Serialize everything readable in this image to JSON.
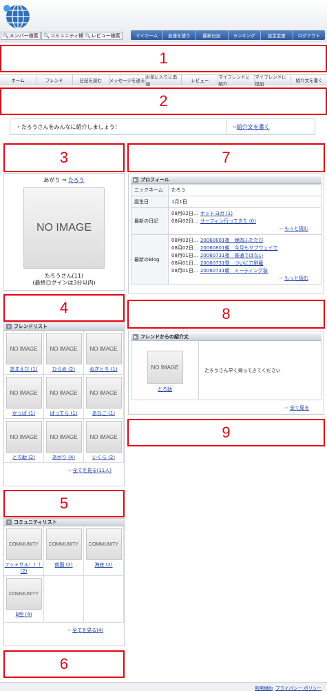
{
  "header": {
    "search": [
      "メンバー検索",
      "コミュニティ検索",
      "レビュー検索"
    ],
    "nav": [
      "マイホーム",
      "友達を誘う",
      "最新日記",
      "ランキング",
      "設定変更",
      "ログアウト"
    ]
  },
  "markers": [
    "1",
    "2",
    "3",
    "4",
    "5",
    "6",
    "7",
    "8",
    "9"
  ],
  "tabs": [
    "ホーム",
    "フレンド",
    "日記を読む",
    "メッセージを送る",
    "お気に入りに追加",
    "レビュー",
    "マイフレンドに紹介",
    "マイフレンドに追加",
    "紹介文を書く"
  ],
  "intro": {
    "text": "・たろうさんをみんなに紹介しましょう！",
    "link": "紹介文を書く"
  },
  "profile_photo": {
    "prefix": "あがり ⇒",
    "link": "たろう",
    "image": "NO IMAGE",
    "name": "たろうさん(11)",
    "login": "(最終ログインは3分以内)"
  },
  "friends": {
    "title": "フレンドリスト",
    "image": "NO IMAGE",
    "items": [
      "あまえび (1)",
      "ひらめ (2)",
      "ねぎとろ (1)",
      "かっぱ (1)",
      "ばってら (1)",
      "あなご (1)",
      "とろ助 (2)",
      "あがり (4)",
      "いくら (2)"
    ],
    "more": "全てを見る(11人)"
  },
  "communities": {
    "title": "コミュニティリスト",
    "image": "COMMUNITY",
    "items": [
      "フットサル！！！ (2)",
      "南国 (2)",
      "海底 (2)",
      "B型 (4)"
    ],
    "more": "全てを見る(4)"
  },
  "profile": {
    "title": "プロフィール",
    "nick_label": "ニックネーム",
    "nick": "たろう",
    "birth_label": "誕生日",
    "birth": "1月1日",
    "diary_label": "最新の日記",
    "diary": [
      {
        "date": "08月02日…",
        "title": "ホットヨガ (1)"
      },
      {
        "date": "08月02日…",
        "title": "サーフィン行ってきた (0)"
      }
    ],
    "blog_label": "最新のBlog",
    "blog": [
      {
        "date": "08月02日…",
        "title": "20060801夜　焼肉ふたたび"
      },
      {
        "date": "08月02日…",
        "title": "20060801朝　今月もサブウェイで"
      },
      {
        "date": "08月01日…",
        "title": "20060731夜　普通ではない"
      },
      {
        "date": "08月01日…",
        "title": "20060731昼　ついに刀剣籠"
      },
      {
        "date": "08月01日…",
        "title": "20060731朝　ミーティング装"
      }
    ],
    "more": "もっと読む"
  },
  "testimonial": {
    "title": "フレンドからの紹介文",
    "image": "NO IMAGE",
    "name": "とろ助",
    "text": "たろうさん早く帰ってきてください",
    "more": "全て見る"
  },
  "footer": {
    "terms": "利用規約",
    "privacy": "プライバシー ポリシー"
  }
}
